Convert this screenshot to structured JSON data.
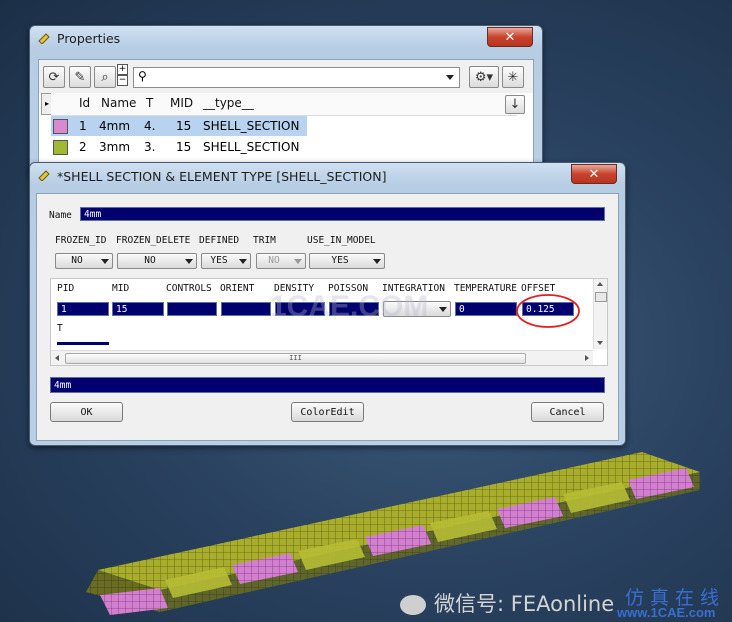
{
  "properties": {
    "title": "Properties",
    "close": "✕",
    "columns": [
      "Id",
      "Name",
      "T",
      "MID",
      "__type__"
    ],
    "rows": [
      {
        "color": "#d88ad0",
        "id": "1",
        "name": "4mm",
        "t": "4.",
        "mid": "15",
        "type": "SHELL_SECTION"
      },
      {
        "color": "#a0b832",
        "id": "2",
        "name": "3mm",
        "t": "3.",
        "mid": "15",
        "type": "SHELL_SECTION"
      }
    ]
  },
  "dialog": {
    "title": "*SHELL SECTION & ELEMENT TYPE [SHELL_SECTION]",
    "close": "✕",
    "name_label": "Name",
    "name_value": "4mm",
    "flags": [
      {
        "label": "FROZEN_ID",
        "value": "NO"
      },
      {
        "label": "FROZEN_DELETE",
        "value": "NO"
      },
      {
        "label": "DEFINED",
        "value": "YES"
      },
      {
        "label": "TRIM",
        "value": "NO"
      },
      {
        "label": "USE_IN_MODEL",
        "value": "YES"
      }
    ],
    "grid_headers": [
      "PID",
      "MID",
      "CONTROLS",
      "ORIENT",
      "DENSITY",
      "POISSON",
      "INTEGRATION",
      "TEMPERATURE",
      "OFFSET"
    ],
    "grid_values": {
      "pid": "1",
      "mid": "15",
      "temperature": "0",
      "offset": "0.125"
    },
    "row2_label": "T",
    "scroll_thumb": "III",
    "comment_value": "4mm",
    "ok": "OK",
    "coloredit": "ColorEdit",
    "cancel": "Cancel"
  },
  "watermark": {
    "center": "1CAE.COM",
    "wechat": "微信号: FEAonline",
    "site": "www.1CAE.com",
    "site_cn": "仿真在线"
  },
  "colors": {
    "selected_row": "#b7d3f0",
    "field_bg": "#00006e",
    "annotation": "#e02020",
    "pink": "#d27fcf",
    "olive": "#a7ad2a"
  }
}
